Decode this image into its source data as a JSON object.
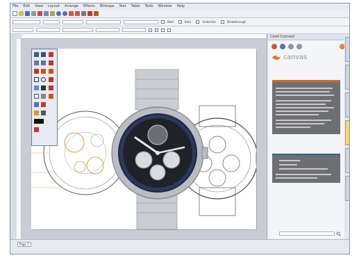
{
  "app": {
    "accent": "#c66a2a",
    "menu": [
      "File",
      "Edit",
      "View",
      "Layout",
      "Arrange",
      "Effects",
      "Bitmaps",
      "Text",
      "Table",
      "Tools",
      "Window",
      "Help"
    ]
  },
  "toolbar_icons": [
    "new-icon",
    "open-icon",
    "save-icon",
    "print-icon",
    "cut-icon",
    "copy-icon",
    "paste-icon",
    "undo-icon",
    "redo-icon",
    "import-icon",
    "export-icon",
    "zoom-icon",
    "snap-icon",
    "options-icon"
  ],
  "property_bar": {
    "checkboxes": [
      "Bold",
      "Italic",
      "Underline",
      "Strikethrough"
    ]
  },
  "docker": {
    "title": "Corel Connect",
    "brand_name": "canvas",
    "search_icon": "search-icon"
  },
  "page_tabs": [
    "Page 1"
  ],
  "colors": {
    "window_bg": "#d9dde6",
    "panel_dark": "#6e6f73",
    "tab_active": "#f6d57a"
  }
}
